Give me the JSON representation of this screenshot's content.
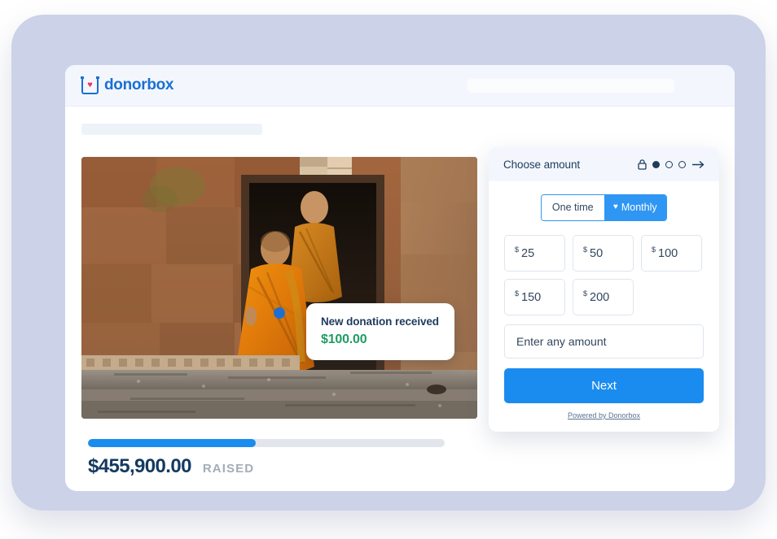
{
  "brand": {
    "logo_text": "donorbox",
    "logo_icon": "donorbox-box-heart-icon",
    "accent_blue": "#1a8cf0",
    "logo_blue": "#1a6fd4",
    "heart_red": "#e8365d",
    "frame_lavender": "#ccd2e8"
  },
  "campaign": {
    "photo_alt": "Two Buddhist monks in orange robes walking out of an ancient stone temple doorway",
    "progress_percent": 47,
    "raised_amount": "$455,900.00",
    "raised_label": "RAISED"
  },
  "toast": {
    "title": "New donation received",
    "amount": "$100.00",
    "amount_color": "#1f9d62"
  },
  "form": {
    "header_title": "Choose amount",
    "lock_icon": "lock-icon",
    "arrow_icon": "arrow-right-icon",
    "steps": [
      {
        "state": "filled"
      },
      {
        "state": "empty"
      },
      {
        "state": "empty"
      }
    ],
    "frequency": {
      "one_time_label": "One time",
      "monthly_label": "Monthly",
      "monthly_icon": "heart-icon",
      "selected": "Monthly"
    },
    "currency_symbol": "$",
    "amounts": [
      "25",
      "50",
      "100",
      "150",
      "200"
    ],
    "custom_amount_placeholder": "Enter any amount",
    "custom_amount_value": "",
    "next_label": "Next",
    "powered_by": "Powered by Donorbox"
  }
}
